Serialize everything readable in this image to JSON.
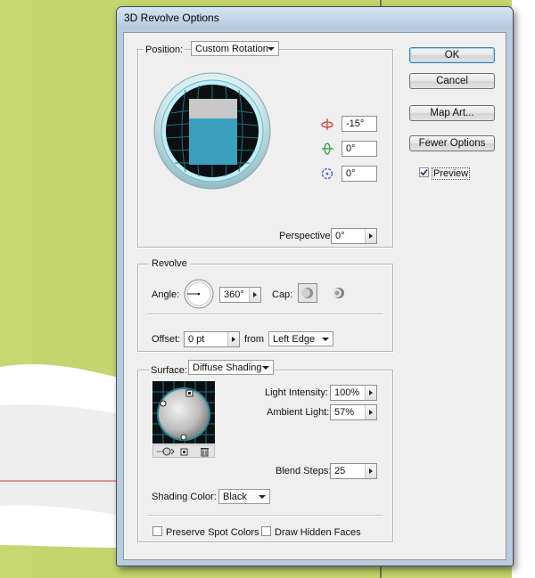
{
  "dialog": {
    "title": "3D Revolve Options"
  },
  "position": {
    "label": "Position:",
    "value": "Custom Rotation",
    "x_rotation": "-15°",
    "y_rotation": "0°",
    "z_rotation": "0°",
    "perspective_label": "Perspective:",
    "perspective_value": "0°"
  },
  "revolve": {
    "group_label": "Revolve",
    "angle_label": "Angle:",
    "angle_value": "360°",
    "cap_label": "Cap:",
    "offset_label": "Offset:",
    "offset_value": "0 pt",
    "from_label": "from",
    "from_value": "Left Edge"
  },
  "surface": {
    "label": "Surface:",
    "value": "Diffuse Shading",
    "light_intensity_label": "Light Intensity:",
    "light_intensity_value": "100%",
    "ambient_light_label": "Ambient Light:",
    "ambient_light_value": "57%",
    "blend_steps_label": "Blend Steps:",
    "blend_steps_value": "25",
    "shading_color_label": "Shading Color:",
    "shading_color_value": "Black",
    "preserve_spot_label": "Preserve Spot Colors",
    "draw_hidden_label": "Draw Hidden Faces"
  },
  "buttons": {
    "ok": "OK",
    "cancel": "Cancel",
    "map_art": "Map Art...",
    "fewer_options": "Fewer Options",
    "preview": "Preview"
  },
  "colors": {
    "background_green": "#c3d56c",
    "cube_blue": "#3aa0be",
    "dialog_frame": "#b9cbdc"
  }
}
